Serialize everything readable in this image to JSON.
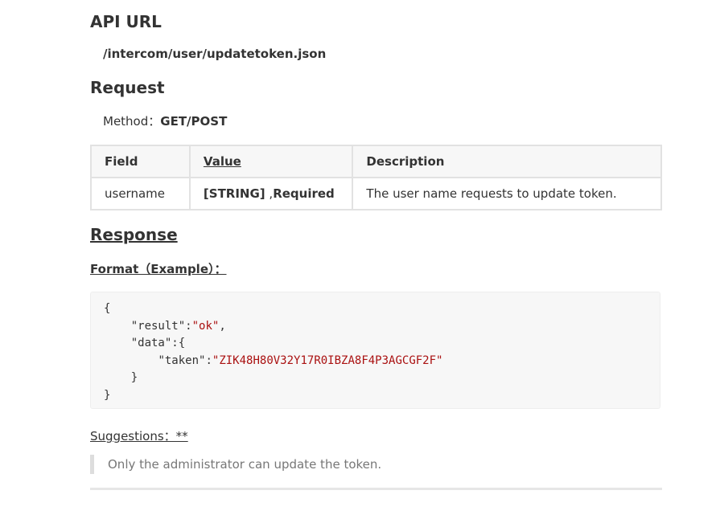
{
  "api_url": {
    "heading": "API URL",
    "path": "/intercom/user/updatetoken.json"
  },
  "request": {
    "heading": "Request",
    "method_label": "Method：",
    "method_value": "GET/POST",
    "table": {
      "headers": [
        "Field",
        "Value",
        "Description"
      ],
      "rows": [
        {
          "field": "username",
          "value_type": "[STRING]",
          "value_sep": " ,",
          "value_required": "Required",
          "description": "The user name requests to update token."
        }
      ]
    }
  },
  "response": {
    "heading": "Response",
    "format_label": "Format（Example）： ",
    "code": {
      "line1": "{",
      "result_key": "\"result\"",
      "result_colon": ":",
      "result_val": "\"ok\"",
      "result_comma": ",",
      "data_key": "\"data\"",
      "data_open": ":{",
      "taken_key": "\"taken\"",
      "taken_colon": ":",
      "taken_val": "\"ZIK48H80V32Y17R0IBZA8F4P3AGCGF2F\"",
      "data_close": "}",
      "line_last": "}"
    }
  },
  "suggestions": {
    "label": "Suggestions：**",
    "quote": "Only the administrator can update the token."
  }
}
